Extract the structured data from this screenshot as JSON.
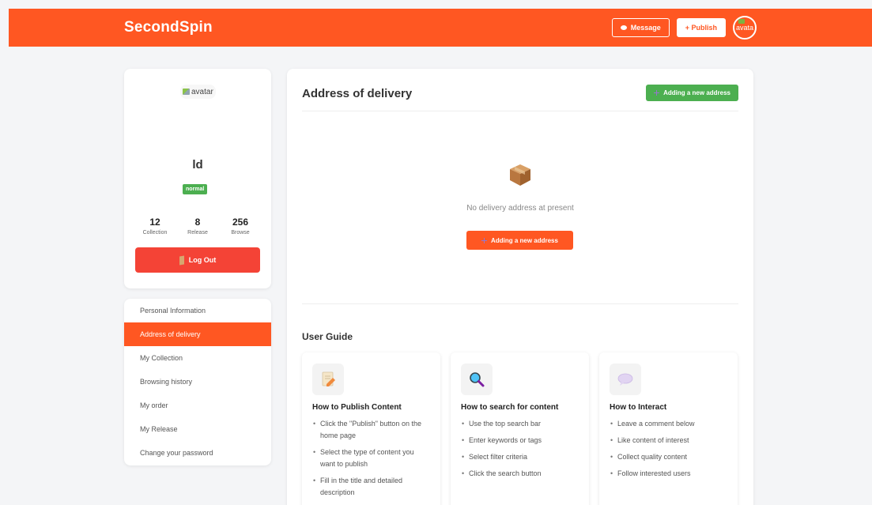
{
  "header": {
    "brand": "SecondSpin",
    "message_label": "Message",
    "publish_label": "+ Publish",
    "avatar_alt": "avata",
    "accent_color": "#ff5722"
  },
  "profile": {
    "avatar_alt": "avatar",
    "username": "ld",
    "level": "normal",
    "stats": [
      {
        "value": "12",
        "label": "Collection"
      },
      {
        "value": "8",
        "label": "Release"
      },
      {
        "value": "256",
        "label": "Browse"
      }
    ],
    "logout_label": "Log Out"
  },
  "sidebar": {
    "items": [
      {
        "label": "Personal Information"
      },
      {
        "label": "Address of delivery"
      },
      {
        "label": "My Collection"
      },
      {
        "label": "Browsing history"
      },
      {
        "label": "My order"
      },
      {
        "label": "My Release"
      },
      {
        "label": "Change your password"
      }
    ],
    "active_index": 1
  },
  "main": {
    "title": "Address of delivery",
    "add_button_label": "Adding a new address",
    "empty_text": "No delivery address at present",
    "empty_button_label": "Adding a new address",
    "guide": {
      "title": "User Guide",
      "cards": [
        {
          "icon": "pencil-paper-icon",
          "heading": "How to Publish Content",
          "steps": [
            "Click the \"Publish\" button on the home page",
            "Select the type of content you want to publish",
            "Fill in the title and detailed description"
          ]
        },
        {
          "icon": "magnifier-icon",
          "heading": "How to search for content",
          "steps": [
            "Use the top search bar",
            "Enter keywords or tags",
            "Select filter criteria",
            "Click the search button"
          ]
        },
        {
          "icon": "speech-bubble-icon",
          "heading": "How to Interact",
          "steps": [
            "Leave a comment below",
            "Like content of interest",
            "Collect quality content",
            "Follow interested users"
          ]
        }
      ]
    }
  },
  "colors": {
    "primary": "#ff5722",
    "success": "#4caf50",
    "danger": "#f44336"
  }
}
